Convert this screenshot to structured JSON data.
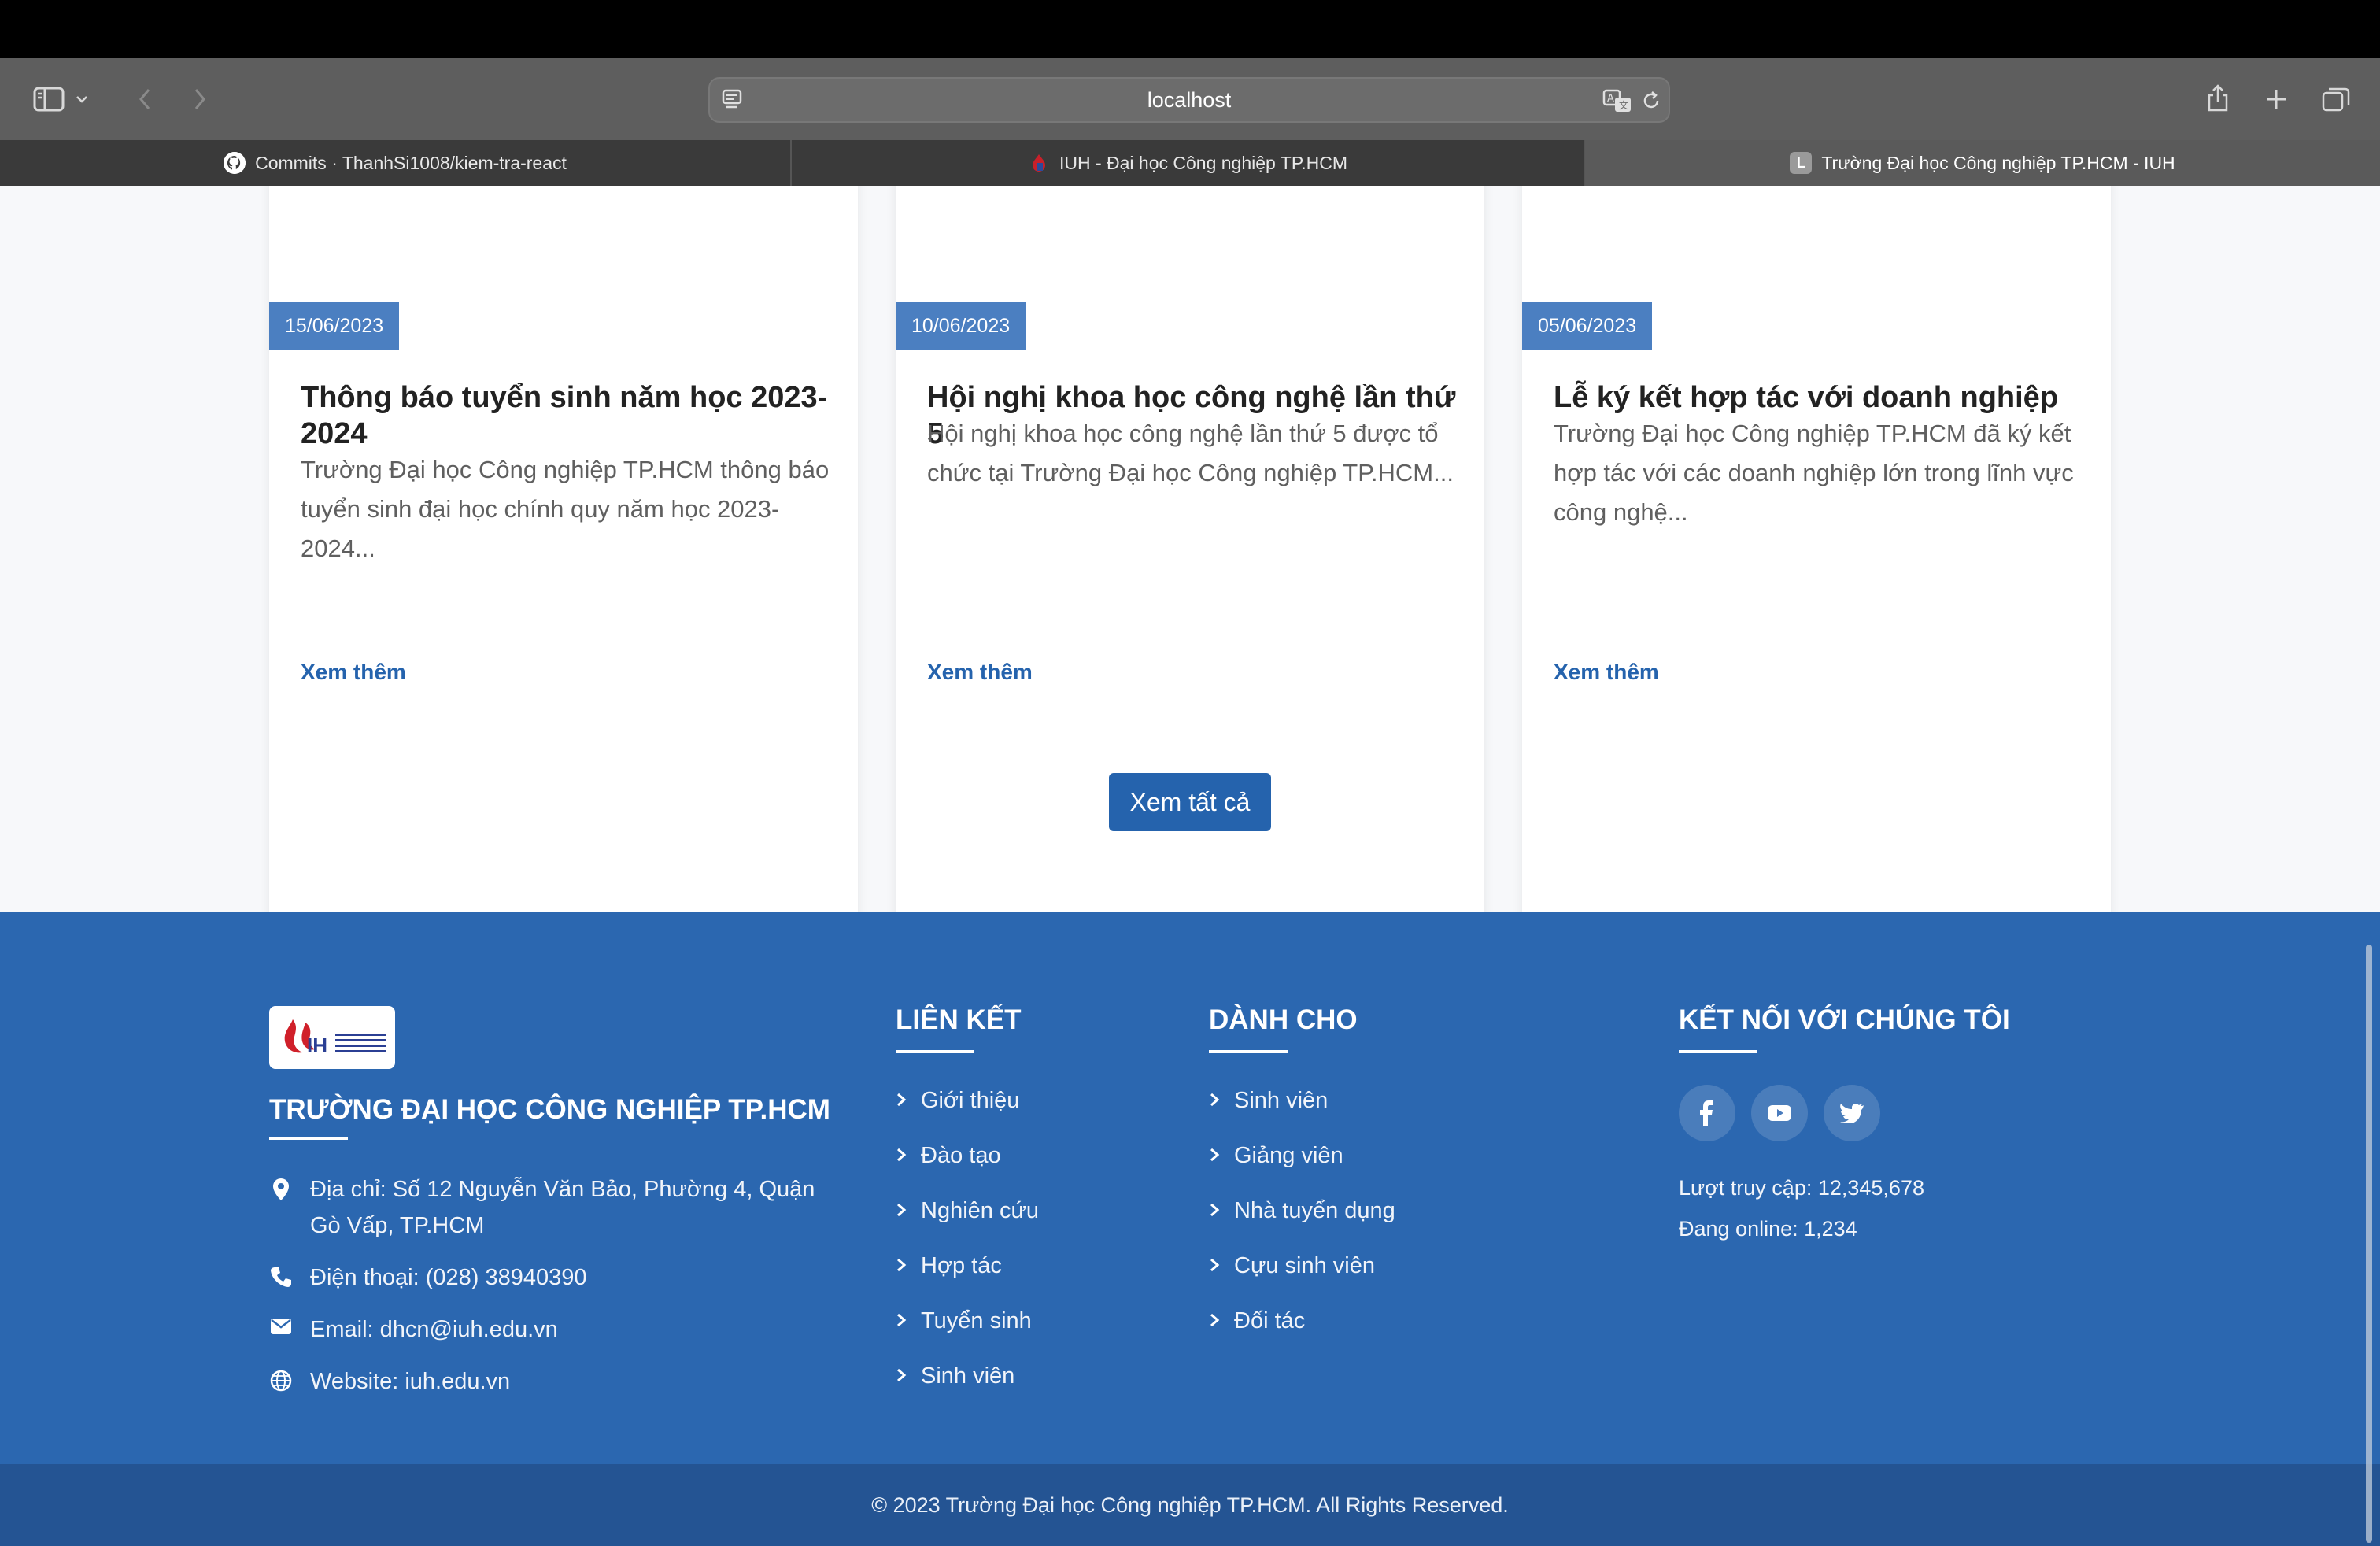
{
  "browser": {
    "address": "localhost",
    "tabs": [
      {
        "label": "Commits · ThanhSi1008/kiem-tra-react"
      },
      {
        "label": "IUH - Đại học Công nghiệp TP.HCM"
      },
      {
        "label": "Trường Đại học Công nghiệp TP.HCM - IUH",
        "favicon_letter": "L"
      }
    ]
  },
  "news": {
    "cards": [
      {
        "date": "15/06/2023",
        "title": "Thông báo tuyển sinh năm học 2023-2024",
        "desc": "Trường Đại học Công nghiệp TP.HCM thông báo tuyển sinh đại học chính quy năm học 2023-2024...",
        "more": "Xem thêm"
      },
      {
        "date": "10/06/2023",
        "title": "Hội nghị khoa học công nghệ lần thứ 5",
        "desc": "Hội nghị khoa học công nghệ lần thứ 5 được tổ chức tại Trường Đại học Công nghiệp TP.HCM...",
        "more": "Xem thêm"
      },
      {
        "date": "05/06/2023",
        "title": "Lễ ký kết hợp tác với doanh nghiệp",
        "desc": "Trường Đại học Công nghiệp TP.HCM đã ký kết hợp tác với các doanh nghiệp lớn trong lĩnh vực công nghệ...",
        "more": "Xem thêm"
      }
    ],
    "view_all": "Xem tất cả"
  },
  "footer": {
    "school_name": "TRƯỜNG ĐẠI HỌC CÔNG NGHIỆP TP.HCM",
    "address": "Địa chỉ: Số 12 Nguyễn Văn Bảo, Phường 4, Quận Gò Vấp, TP.HCM",
    "phone": "Điện thoại: (028) 38940390",
    "email": "Email: dhcn@iuh.edu.vn",
    "website": "Website: iuh.edu.vn",
    "links_title": "LIÊN KẾT",
    "links": [
      "Giới thiệu",
      "Đào tạo",
      "Nghiên cứu",
      "Hợp tác",
      "Tuyển sinh",
      "Sinh viên"
    ],
    "for_title": "DÀNH CHO",
    "for_links": [
      "Sinh viên",
      "Giảng viên",
      "Nhà tuyển dụng",
      "Cựu sinh viên",
      "Đối tác"
    ],
    "connect_title": "KẾT NỐI VỚI CHÚNG TÔI",
    "social_icons": [
      "facebook-icon",
      "youtube-icon",
      "twitter-icon"
    ],
    "visits": "Lượt truy cập: 12,345,678",
    "online": "Đang online: 1,234",
    "copyright": "© 2023 Trường Đại học Công nghiệp TP.HCM. All Rights Reserved."
  },
  "colors": {
    "primary": "#2b67b0",
    "date_badge": "#4b7fc1",
    "link": "#2563ad",
    "footer_bottom": "#245493"
  }
}
